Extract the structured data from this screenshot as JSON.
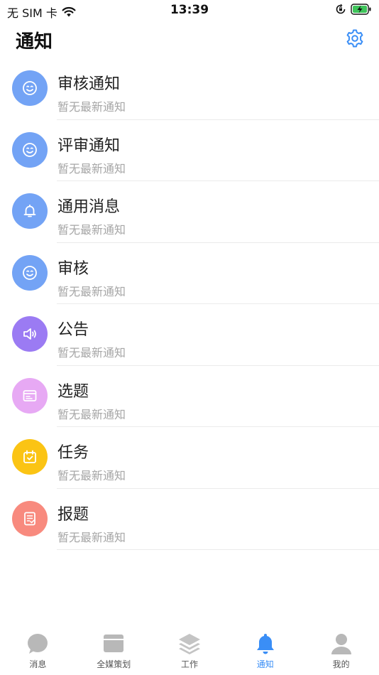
{
  "status_bar": {
    "carrier": "无 SIM 卡",
    "time": "13:39"
  },
  "header": {
    "title": "通知",
    "settings_icon": "gear-icon"
  },
  "notifications": [
    {
      "title": "审核通知",
      "subtitle": "暂无最新通知",
      "icon": "smile-icon",
      "color": "#73a3f5"
    },
    {
      "title": "评审通知",
      "subtitle": "暂无最新通知",
      "icon": "smile-icon",
      "color": "#73a3f5"
    },
    {
      "title": "通用消息",
      "subtitle": "暂无最新通知",
      "icon": "bell-icon",
      "color": "#73a3f5"
    },
    {
      "title": "审核",
      "subtitle": "暂无最新通知",
      "icon": "smile-icon",
      "color": "#73a3f5"
    },
    {
      "title": "公告",
      "subtitle": "暂无最新通知",
      "icon": "speaker-icon",
      "color": "#9b7bf3"
    },
    {
      "title": "选题",
      "subtitle": "暂无最新通知",
      "icon": "card-icon",
      "color": "#e7a9f4"
    },
    {
      "title": "任务",
      "subtitle": "暂无最新通知",
      "icon": "calendar-check-icon",
      "color": "#fbc414"
    },
    {
      "title": "报题",
      "subtitle": "暂无最新通知",
      "icon": "checklist-icon",
      "color": "#f88a7e"
    }
  ],
  "tabs": [
    {
      "label": "消息",
      "icon": "chat-bubble-icon",
      "active": false
    },
    {
      "label": "全媒策划",
      "icon": "calendar-icon",
      "active": false
    },
    {
      "label": "工作",
      "icon": "layers-icon",
      "active": false
    },
    {
      "label": "通知",
      "icon": "bell-icon",
      "active": true
    },
    {
      "label": "我的",
      "icon": "person-icon",
      "active": false
    }
  ],
  "colors": {
    "accent": "#3a8ef6",
    "inactive_icon": "#b8b8b8",
    "subtitle": "#a6a6a6"
  }
}
